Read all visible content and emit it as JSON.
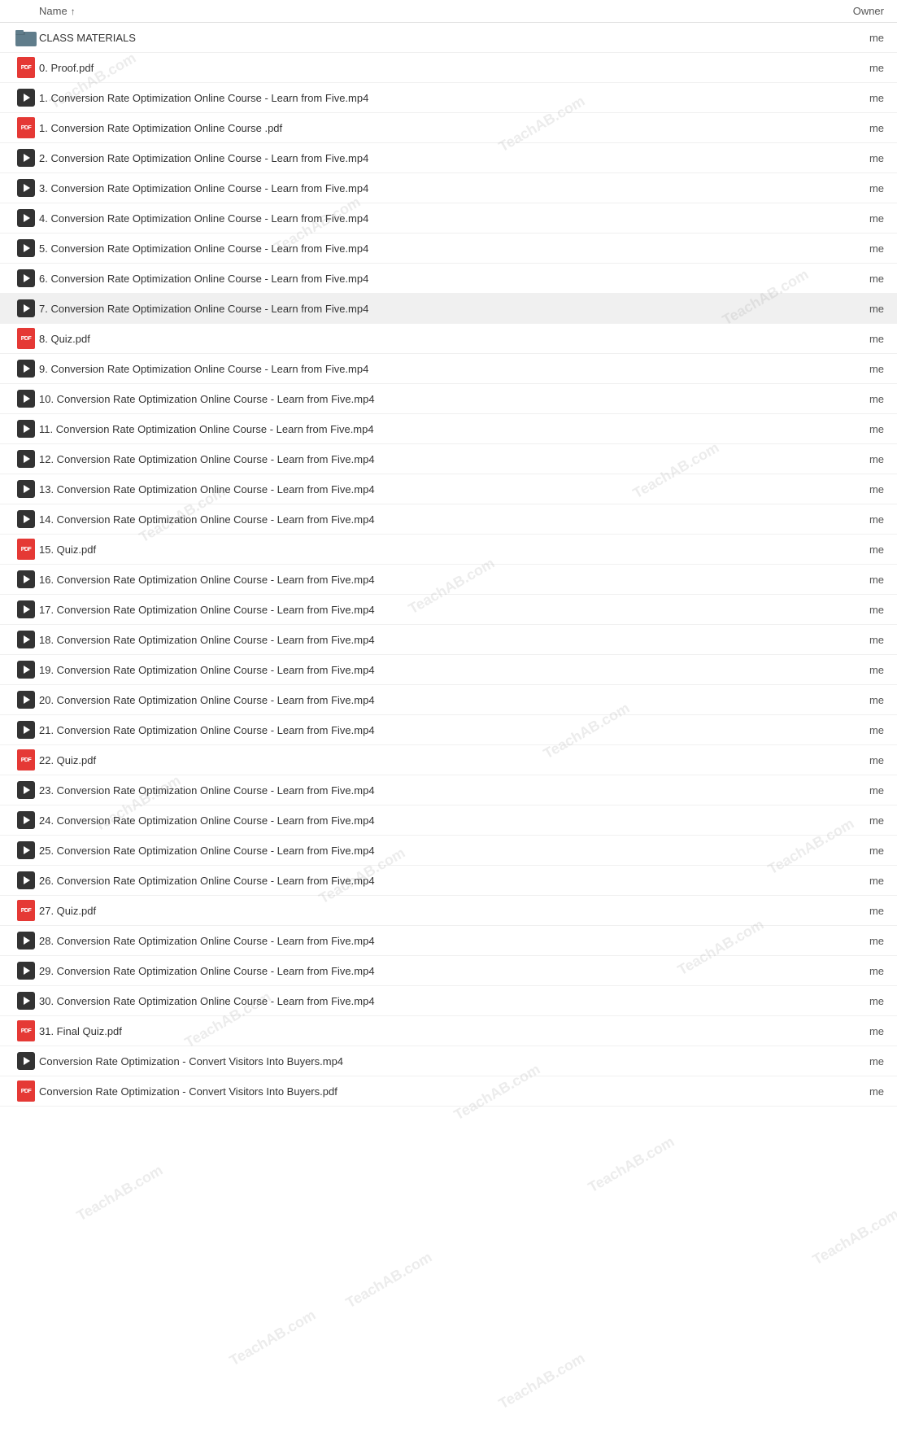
{
  "header": {
    "name_label": "Name",
    "owner_label": "Owner",
    "sort_direction": "↑"
  },
  "rows": [
    {
      "id": "folder",
      "type": "folder",
      "name": "CLASS MATERIALS",
      "owner": "me",
      "highlighted": false
    },
    {
      "id": "0",
      "type": "pdf",
      "name": "0. Proof.pdf",
      "owner": "me",
      "highlighted": false
    },
    {
      "id": "1v",
      "type": "video",
      "name": "1. Conversion Rate Optimization Online Course - Learn from Five.mp4",
      "owner": "me",
      "highlighted": false
    },
    {
      "id": "1p",
      "type": "pdf",
      "name": "1. Conversion Rate Optimization Online Course .pdf",
      "owner": "me",
      "highlighted": false
    },
    {
      "id": "2v",
      "type": "video",
      "name": "2. Conversion Rate Optimization Online Course - Learn from Five.mp4",
      "owner": "me",
      "highlighted": false
    },
    {
      "id": "3v",
      "type": "video",
      "name": "3. Conversion Rate Optimization Online Course - Learn from Five.mp4",
      "owner": "me",
      "highlighted": false
    },
    {
      "id": "4v",
      "type": "video",
      "name": "4. Conversion Rate Optimization Online Course - Learn from Five.mp4",
      "owner": "me",
      "highlighted": false
    },
    {
      "id": "5v",
      "type": "video",
      "name": "5. Conversion Rate Optimization Online Course - Learn from Five.mp4",
      "owner": "me",
      "highlighted": false
    },
    {
      "id": "6v",
      "type": "video",
      "name": "6. Conversion Rate Optimization Online Course - Learn from Five.mp4",
      "owner": "me",
      "highlighted": false
    },
    {
      "id": "7v",
      "type": "video",
      "name": "7. Conversion Rate Optimization Online Course - Learn from Five.mp4",
      "owner": "me",
      "highlighted": true
    },
    {
      "id": "8p",
      "type": "pdf",
      "name": "8. Quiz.pdf",
      "owner": "me",
      "highlighted": false
    },
    {
      "id": "9v",
      "type": "video",
      "name": "9. Conversion Rate Optimization Online Course - Learn from Five.mp4",
      "owner": "me",
      "highlighted": false
    },
    {
      "id": "10v",
      "type": "video",
      "name": "10. Conversion Rate Optimization Online Course - Learn from Five.mp4",
      "owner": "me",
      "highlighted": false
    },
    {
      "id": "11v",
      "type": "video",
      "name": "11. Conversion Rate Optimization Online Course - Learn from Five.mp4",
      "owner": "me",
      "highlighted": false
    },
    {
      "id": "12v",
      "type": "video",
      "name": "12. Conversion Rate Optimization Online Course - Learn from Five.mp4",
      "owner": "me",
      "highlighted": false
    },
    {
      "id": "13v",
      "type": "video",
      "name": "13. Conversion Rate Optimization Online Course - Learn from Five.mp4",
      "owner": "me",
      "highlighted": false
    },
    {
      "id": "14v",
      "type": "video",
      "name": "14. Conversion Rate Optimization Online Course - Learn from Five.mp4",
      "owner": "me",
      "highlighted": false
    },
    {
      "id": "15p",
      "type": "pdf",
      "name": "15. Quiz.pdf",
      "owner": "me",
      "highlighted": false
    },
    {
      "id": "16v",
      "type": "video",
      "name": "16. Conversion Rate Optimization Online Course - Learn from Five.mp4",
      "owner": "me",
      "highlighted": false
    },
    {
      "id": "17v",
      "type": "video",
      "name": "17. Conversion Rate Optimization Online Course - Learn from Five.mp4",
      "owner": "me",
      "highlighted": false
    },
    {
      "id": "18v",
      "type": "video",
      "name": "18. Conversion Rate Optimization Online Course - Learn from Five.mp4",
      "owner": "me",
      "highlighted": false
    },
    {
      "id": "19v",
      "type": "video",
      "name": "19. Conversion Rate Optimization Online Course - Learn from Five.mp4",
      "owner": "me",
      "highlighted": false
    },
    {
      "id": "20v",
      "type": "video",
      "name": "20. Conversion Rate Optimization Online Course - Learn from Five.mp4",
      "owner": "me",
      "highlighted": false
    },
    {
      "id": "21v",
      "type": "video",
      "name": "21. Conversion Rate Optimization Online Course - Learn from Five.mp4",
      "owner": "me",
      "highlighted": false
    },
    {
      "id": "22p",
      "type": "pdf",
      "name": "22. Quiz.pdf",
      "owner": "me",
      "highlighted": false
    },
    {
      "id": "23v",
      "type": "video",
      "name": "23. Conversion Rate Optimization Online Course - Learn from Five.mp4",
      "owner": "me",
      "highlighted": false
    },
    {
      "id": "24v",
      "type": "video",
      "name": "24. Conversion Rate Optimization Online Course - Learn from Five.mp4",
      "owner": "me",
      "highlighted": false
    },
    {
      "id": "25v",
      "type": "video",
      "name": "25. Conversion Rate Optimization Online Course - Learn from Five.mp4",
      "owner": "me",
      "highlighted": false
    },
    {
      "id": "26v",
      "type": "video",
      "name": "26. Conversion Rate Optimization Online Course - Learn from Five.mp4",
      "owner": "me",
      "highlighted": false
    },
    {
      "id": "27p",
      "type": "pdf",
      "name": "27. Quiz.pdf",
      "owner": "me",
      "highlighted": false
    },
    {
      "id": "28v",
      "type": "video",
      "name": "28. Conversion Rate Optimization Online Course - Learn from Five.mp4",
      "owner": "me",
      "highlighted": false
    },
    {
      "id": "29v",
      "type": "video",
      "name": "29. Conversion Rate Optimization Online Course - Learn from Five.mp4",
      "owner": "me",
      "highlighted": false
    },
    {
      "id": "30v",
      "type": "video",
      "name": "30. Conversion Rate Optimization Online Course - Learn from Five.mp4",
      "owner": "me",
      "highlighted": false
    },
    {
      "id": "31p",
      "type": "pdf",
      "name": "31. Final Quiz.pdf",
      "owner": "me",
      "highlighted": false
    },
    {
      "id": "cvb_v",
      "type": "video",
      "name": "Conversion Rate Optimization - Convert Visitors Into Buyers.mp4",
      "owner": "me",
      "highlighted": false
    },
    {
      "id": "cvb_p",
      "type": "pdf",
      "name": "Conversion Rate Optimization - Convert Visitors Into Buyers.pdf",
      "owner": "me",
      "highlighted": false
    }
  ],
  "watermark": "TeachAB.com"
}
